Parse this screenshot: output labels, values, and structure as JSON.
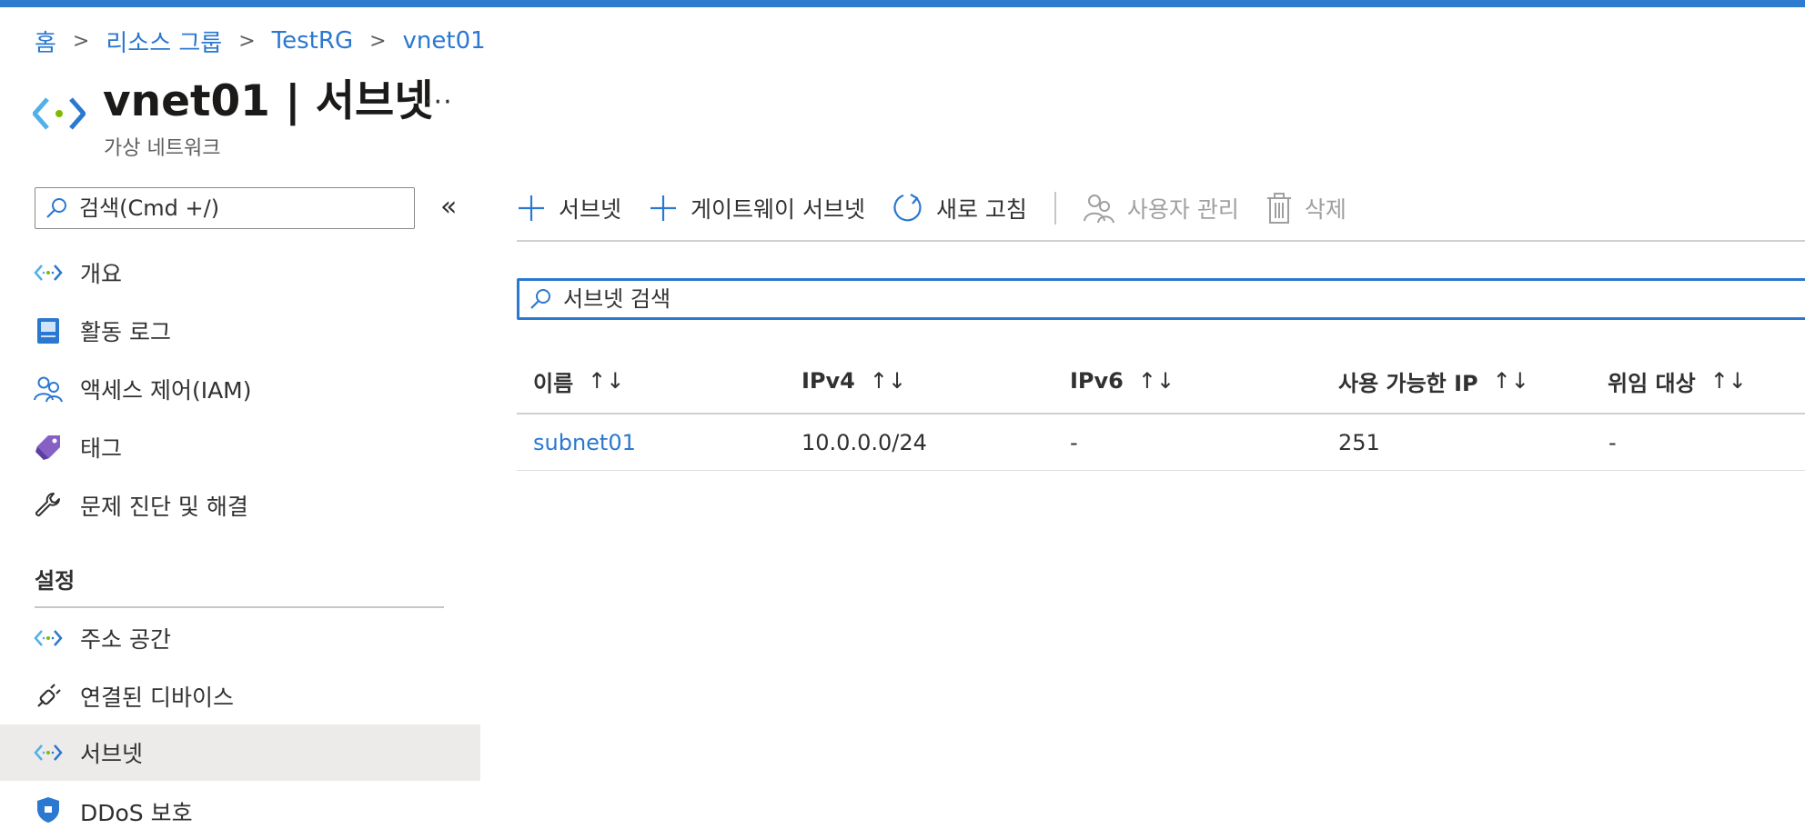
{
  "breadcrumb": {
    "items": [
      "홈",
      "리소스 그룹",
      "TestRG",
      "vnet01"
    ],
    "separator": ">"
  },
  "header": {
    "title": "vnet01 | 서브넷",
    "subtitle": "가상 네트워크",
    "more": "···"
  },
  "sidebar": {
    "search_placeholder": "검색(Cmd +/)",
    "collapse": "«",
    "items": [
      {
        "label": "개요",
        "icon": "vnet-icon"
      },
      {
        "label": "활동 로그",
        "icon": "activity-log-icon"
      },
      {
        "label": "액세스 제어(IAM)",
        "icon": "people-icon"
      },
      {
        "label": "태그",
        "icon": "tag-icon"
      },
      {
        "label": "문제 진단 및 해결",
        "icon": "wrench-icon"
      }
    ],
    "section_settings": "설정",
    "settings_items": [
      {
        "label": "주소 공간",
        "icon": "vnet-icon"
      },
      {
        "label": "연결된 디바이스",
        "icon": "plug-icon"
      },
      {
        "label": "서브넷",
        "icon": "vnet-icon",
        "active": true
      },
      {
        "label": "DDoS 보호",
        "icon": "shield-icon"
      }
    ]
  },
  "toolbar": {
    "add_subnet": "서브넷",
    "add_gateway_subnet": "게이트웨이 서브넷",
    "refresh": "새로 고침",
    "manage_users": "사용자 관리",
    "delete": "삭제"
  },
  "filter": {
    "placeholder": "서브넷 검색"
  },
  "table": {
    "sort_glyph": "↑↓",
    "columns": [
      "이름",
      "IPv4",
      "IPv6",
      "사용 가능한 IP",
      "위임 대상"
    ],
    "rows": [
      [
        "subnet01",
        "10.0.0.0/24",
        "-",
        "251",
        "-"
      ]
    ]
  },
  "colors": {
    "accent": "#2b78d1",
    "top_bar": "#2f7bd0",
    "active_nav_bg": "#edebe9",
    "disabled_text": "#a19f9d"
  }
}
